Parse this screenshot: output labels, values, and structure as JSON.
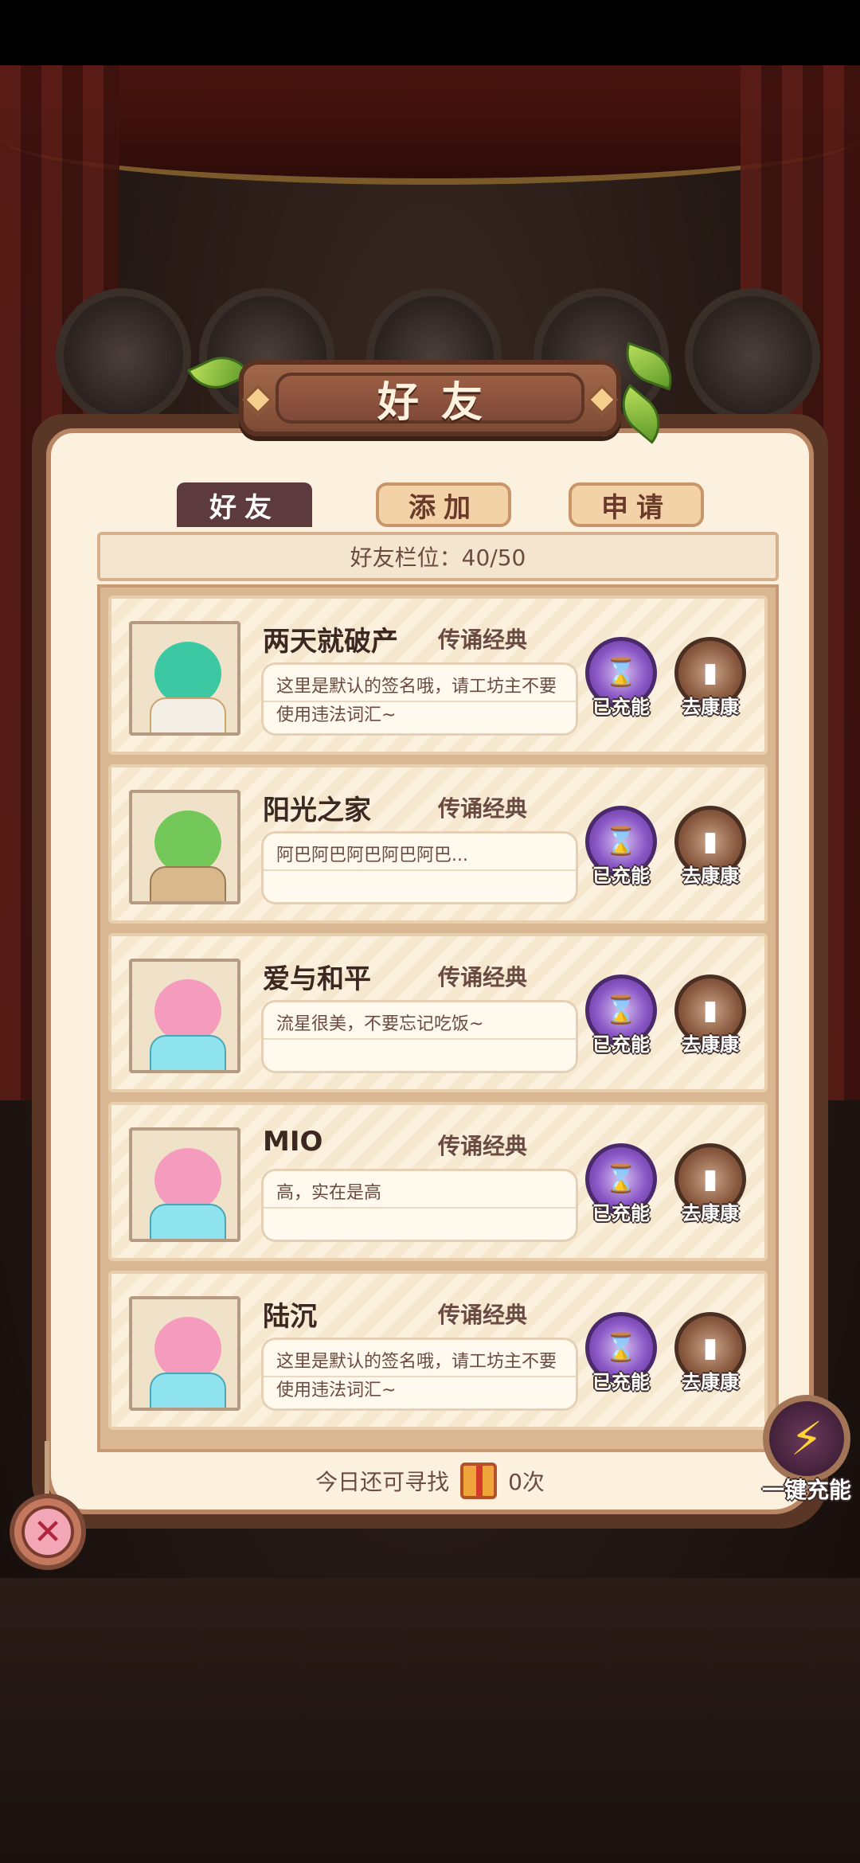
{
  "title": "好友",
  "tabs": [
    {
      "label": "好友",
      "active": true
    },
    {
      "label": "添加",
      "active": false
    },
    {
      "label": "申请",
      "active": false
    }
  ],
  "slot_label": "好友栏位：40/50",
  "friends": [
    {
      "name": "两天就破产",
      "rank": "传诵经典",
      "signature": "这里是默认的签名哦，请工坊主不要使用违法词汇~",
      "charge_label": "已充能",
      "health_label": "去康康",
      "avatar_color": "#3cc8a2"
    },
    {
      "name": "阳光之家",
      "rank": "传诵经典",
      "signature": "阿巴阿巴阿巴阿巴阿巴...",
      "charge_label": "已充能",
      "health_label": "去康康",
      "avatar_color": "#74c85a"
    },
    {
      "name": "爱与和平",
      "rank": "传诵经典",
      "signature": "流星很美，不要忘记吃饭~",
      "charge_label": "已充能",
      "health_label": "去康康",
      "avatar_color": "#f59bbd"
    },
    {
      "name": "MIO",
      "rank": "传诵经典",
      "signature": "高，实在是高",
      "charge_label": "已充能",
      "health_label": "去康康",
      "avatar_color": "#f59bbd"
    },
    {
      "name": "陆沉",
      "rank": "传诵经典",
      "signature": "这里是默认的签名哦，请工坊主不要使用违法词汇~",
      "charge_label": "已充能",
      "health_label": "去康康",
      "avatar_color": "#f59bbd"
    }
  ],
  "footer": {
    "label": "今日还可寻找",
    "count": "0次"
  },
  "one_click_label": "一键充能",
  "icons": {
    "charge": "hourglass-icon",
    "health": "door-icon",
    "lightning": "lightning-icon",
    "close": "close-icon",
    "gift": "gift-icon"
  }
}
